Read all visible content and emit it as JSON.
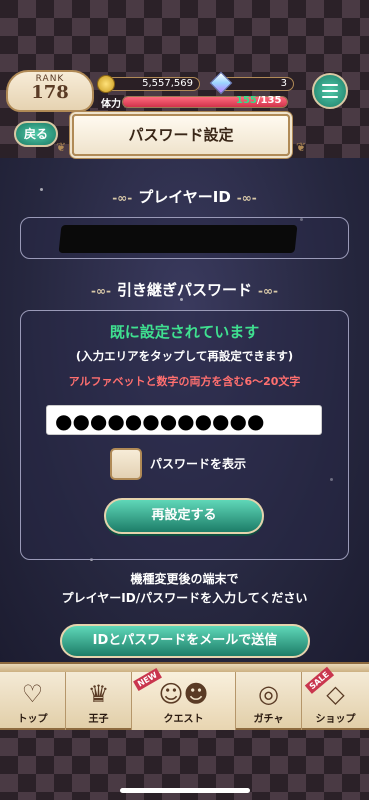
{
  "status_bar": {
    "rank_label": "RANK",
    "rank_value": "178",
    "coins": "5,557,569",
    "gems": "3",
    "stamina_label": "体力",
    "stamina_current": "155",
    "stamina_max": "/135",
    "stamina_fraction": 1.0
  },
  "header": {
    "back_label": "戻る",
    "title": "パスワード設定"
  },
  "player_id": {
    "heading": "プレイヤーID"
  },
  "password": {
    "heading": "引き継ぎパスワード",
    "status": "既に設定されています",
    "hint": "(入力エリアをタップして再設定できます)",
    "rule": "アルファベットと数字の両方を含む6〜20文字",
    "masked_value": "●●●●●●●●●●●●",
    "show_label": "パスワードを表示",
    "reset_label": "再設定する"
  },
  "instructions": {
    "line1": "機種変更後の端末で",
    "line2": "プレイヤーID/パスワードを入力してください"
  },
  "mail_button": "IDとパスワードをメールで送信",
  "nav": {
    "top": "トップ",
    "prince": "王子",
    "quest": "クエスト",
    "gacha": "ガチャ",
    "shop": "ショップ",
    "new_badge": "NEW",
    "sale_badge": "SALE"
  },
  "colors": {
    "accent_green": "#1d7d68",
    "status_green": "#3fe090",
    "rule_red": "#ff6f6f",
    "gold_border": "#b08a56"
  }
}
